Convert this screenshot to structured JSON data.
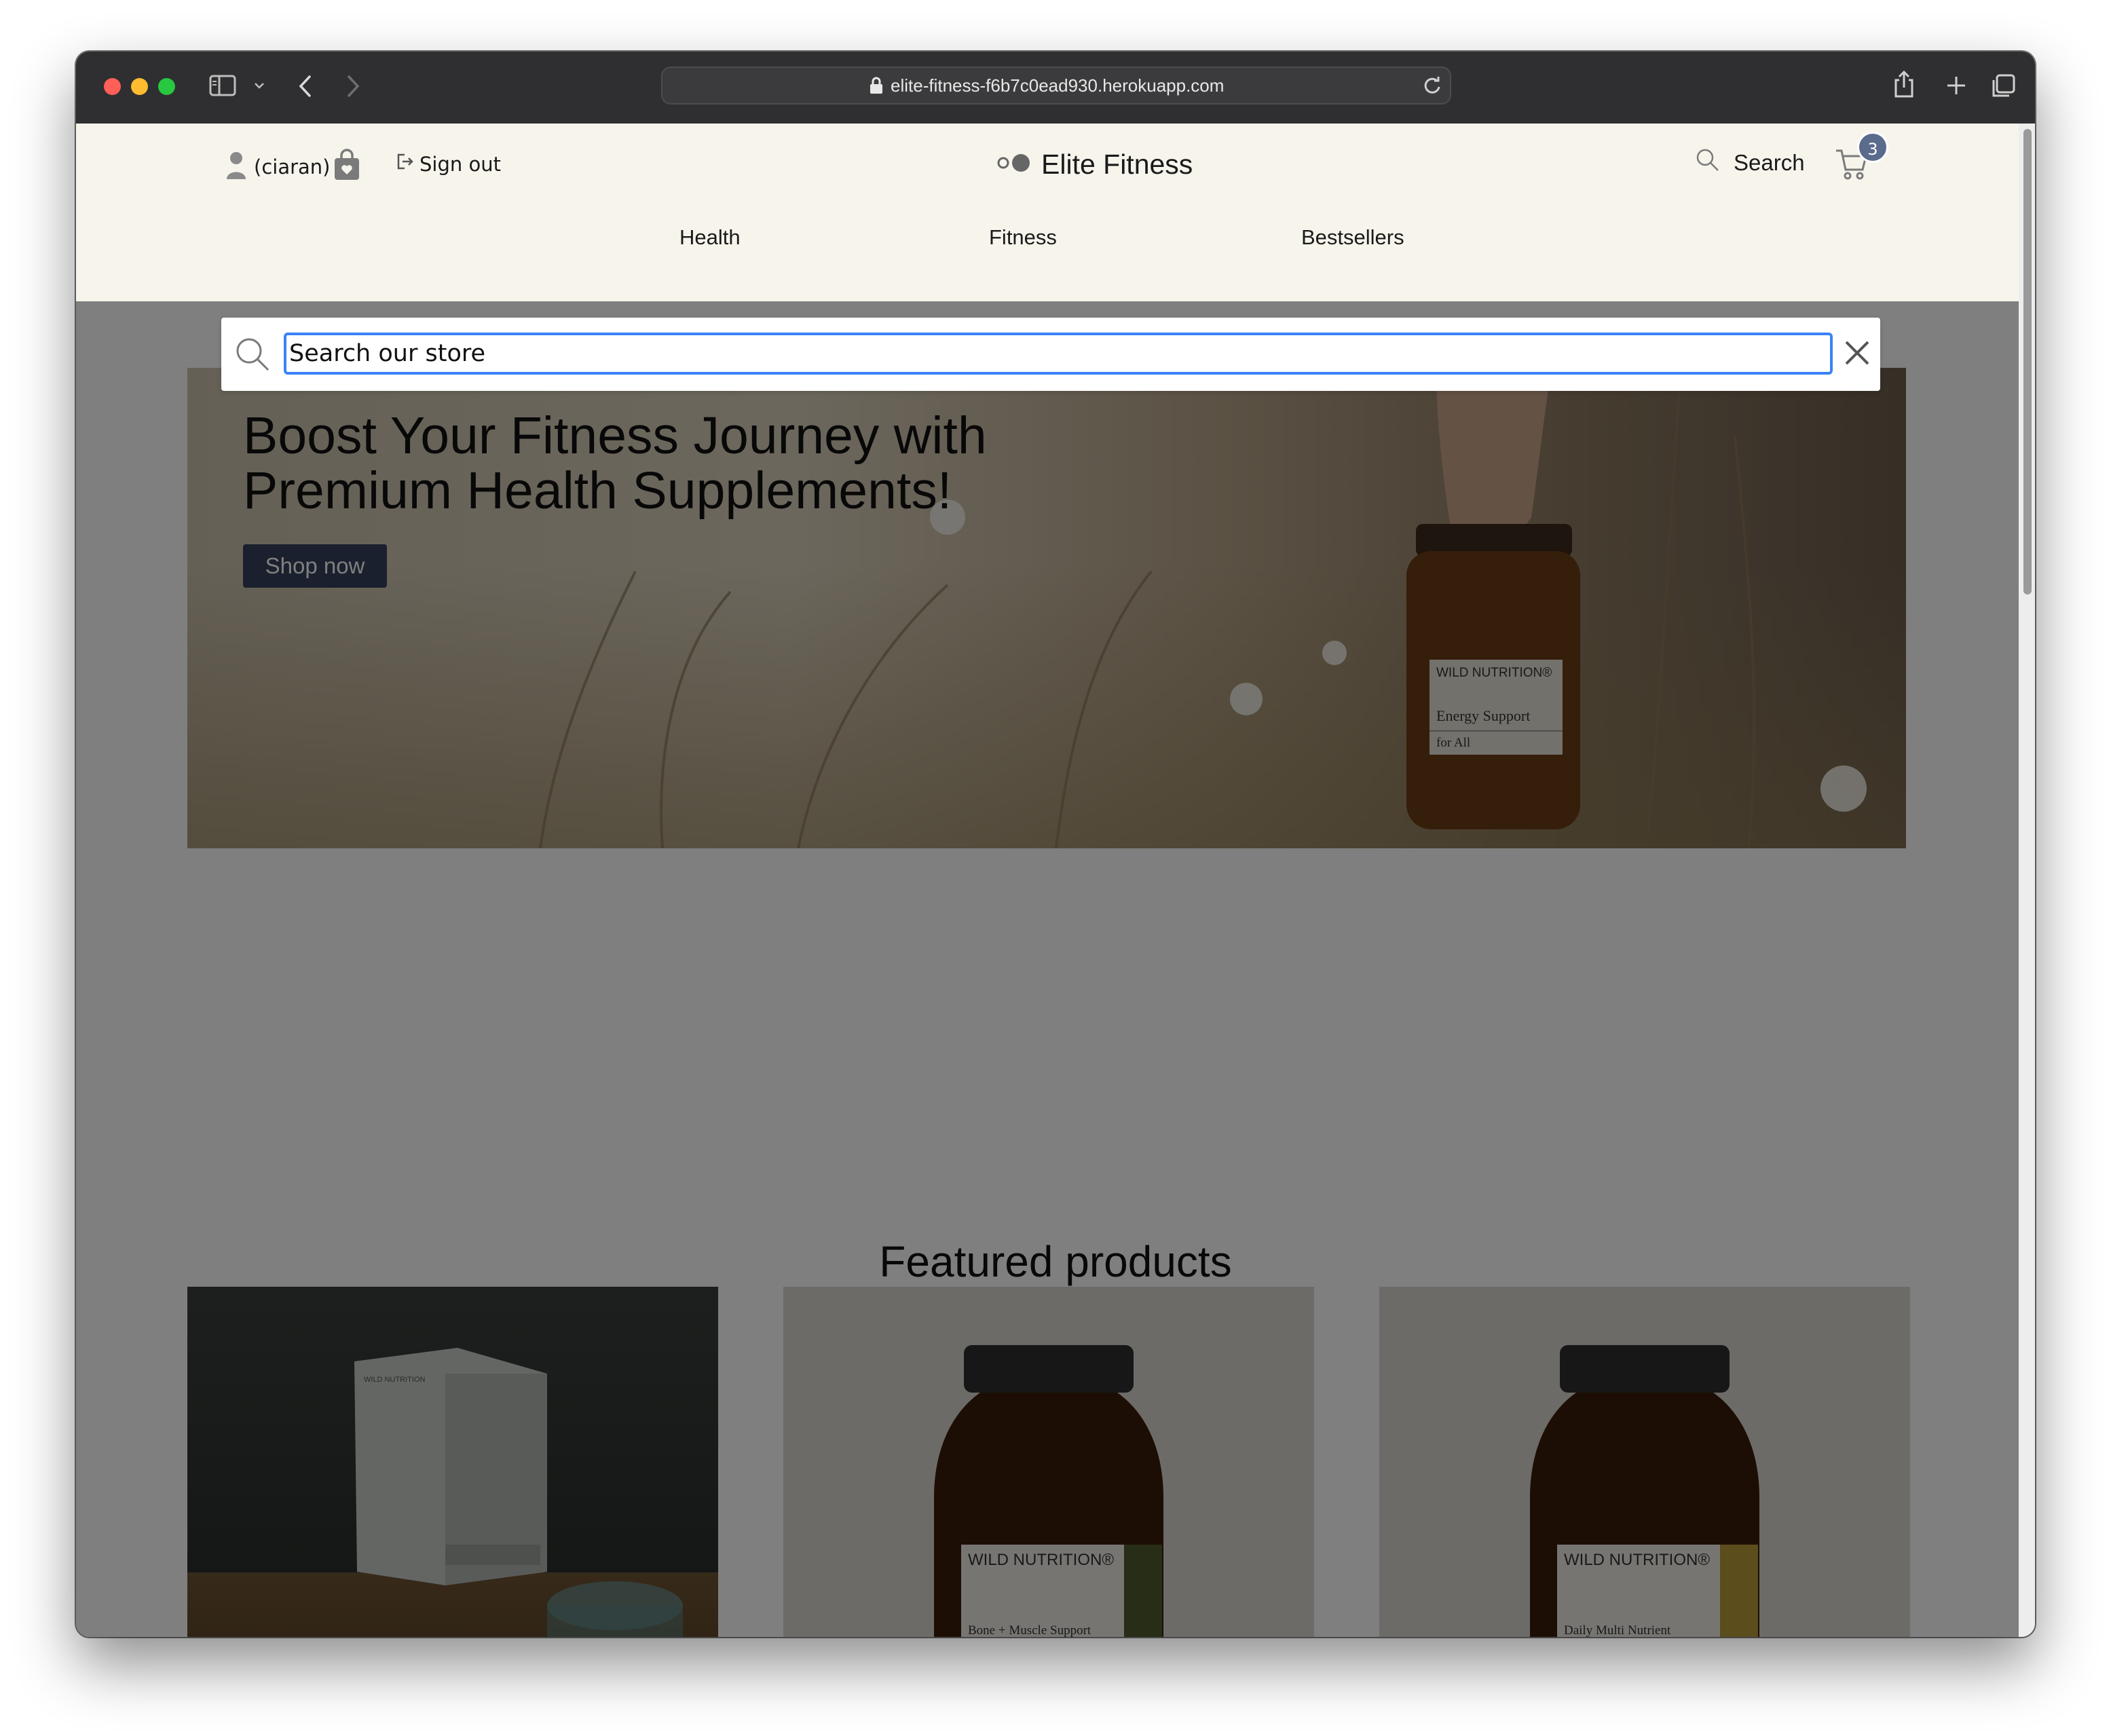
{
  "browser": {
    "url": "elite-fitness-f6b7c0ead930.herokuapp.com"
  },
  "header": {
    "account_label": "(ciaran)",
    "sign_out_label": "Sign out",
    "brand_name": "Elite Fitness",
    "search_label": "Search",
    "cart_count": "3"
  },
  "nav": {
    "items": [
      {
        "label": "Health"
      },
      {
        "label": "Fitness"
      },
      {
        "label": "Bestsellers"
      }
    ]
  },
  "search": {
    "placeholder": "Search our store"
  },
  "hero": {
    "title": "Boost Your Fitness Journey with Premium Health Supplements!",
    "button_label": "Shop now",
    "jar_brand": "WILD NUTRITION®",
    "jar_line1": "Energy Support",
    "jar_line2": "for All"
  },
  "featured": {
    "title": "Featured products",
    "products": [
      {
        "image_text": "WILD NUTRITION"
      },
      {
        "brand": "WILD NUTRITION®",
        "label": "Bone + Muscle Support",
        "accent": "#4e5a2c"
      },
      {
        "brand": "WILD NUTRITION®",
        "label": "Daily Multi Nutrient",
        "accent": "#b89b3a"
      }
    ]
  },
  "colors": {
    "header_bg": "#f7f4ec",
    "button_bg": "#34405a",
    "badge_bg": "#5a6b8c",
    "focus_ring": "#3b82f6"
  }
}
